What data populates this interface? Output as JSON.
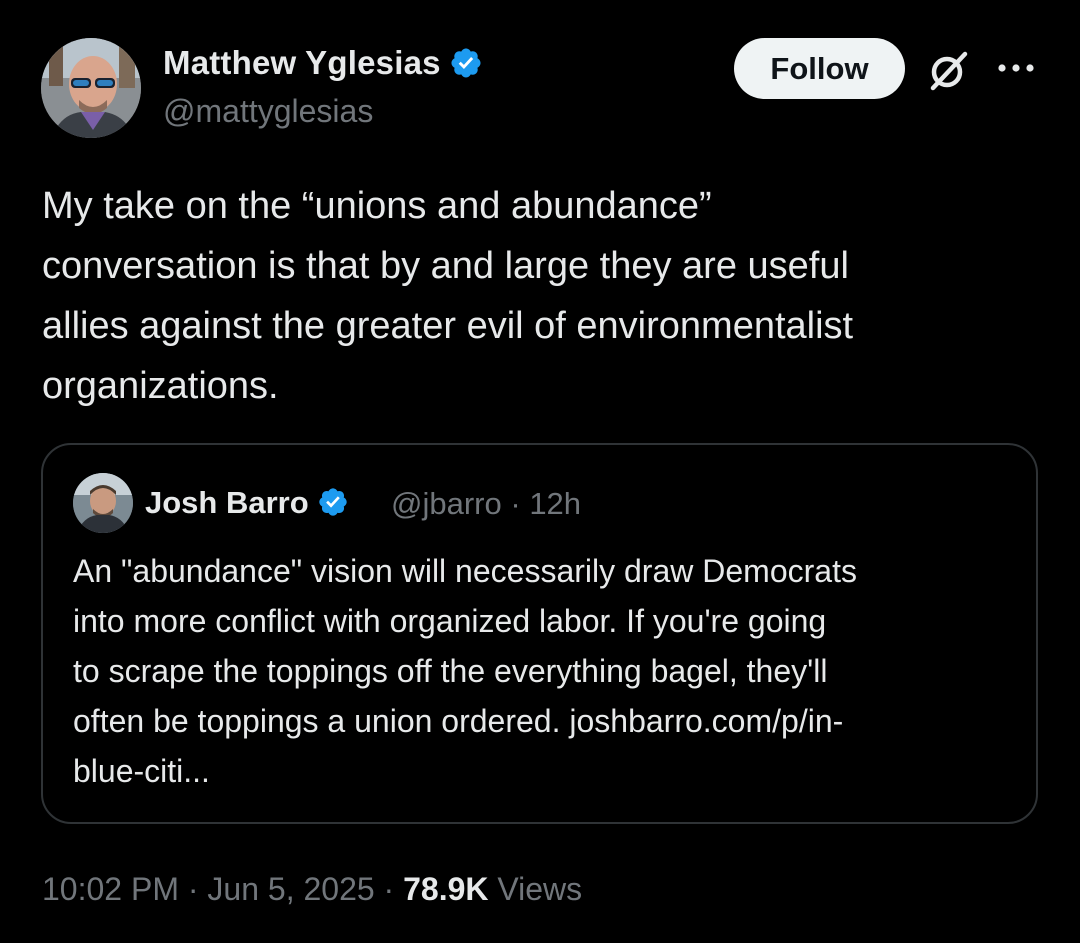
{
  "author": {
    "name": "Matthew Yglesias",
    "handle": "@mattyglesias",
    "verified": true,
    "verified_color": "#1d9bf0"
  },
  "header": {
    "follow_label": "Follow",
    "grok_icon": "no-symbol-icon",
    "more_icon": "more-dots-icon"
  },
  "tweet": {
    "lines": [
      "My take on the “unions and abundance”",
      "conversation is that by and large they are useful",
      "allies against the greater evil of environmentalist",
      "organizations."
    ]
  },
  "quote": {
    "name": "Josh Barro",
    "handle": "@jbarro",
    "separator": "·",
    "age": "12h",
    "verified": true,
    "lines": [
      "An \"abundance\" vision will necessarily draw Democrats",
      "into more conflict with organized labor. If you're going",
      "to scrape the toppings off the everything bagel, they'll",
      "often be toppings a union ordered. joshbarro.com/p/in-",
      "blue-citi..."
    ]
  },
  "footer": {
    "time": "10:02 PM",
    "date": "Jun 5, 2025",
    "separator": "·",
    "views_count": "78.9K",
    "views_label": "Views"
  },
  "colors": {
    "background": "#000000",
    "text": "#e7e9ea",
    "muted": "#71767b",
    "border": "#2f3336",
    "accent": "#1d9bf0"
  }
}
